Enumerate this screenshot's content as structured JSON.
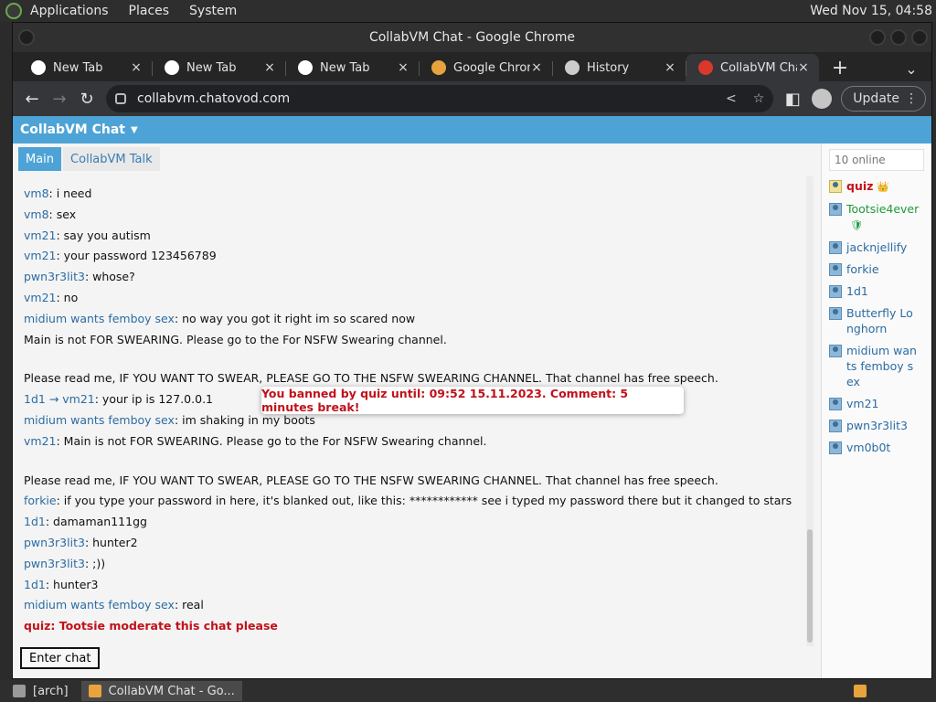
{
  "top_panel": {
    "menus": [
      "Applications",
      "Places",
      "System"
    ],
    "clock": "Wed Nov 15, 04:58"
  },
  "window": {
    "title": "CollabVM Chat - Google Chrome"
  },
  "tabs": [
    {
      "title": "New Tab",
      "icon": "chrome-new-tab-icon",
      "color": "#ffffff"
    },
    {
      "title": "New Tab",
      "icon": "chrome-new-tab-icon",
      "color": "#ffffff"
    },
    {
      "title": "New Tab",
      "icon": "chrome-new-tab-icon",
      "color": "#ffffff"
    },
    {
      "title": "Google Chrome",
      "icon": "chrome-logo-icon",
      "color": "#e8a33d"
    },
    {
      "title": "History",
      "icon": "history-icon",
      "color": "#cccccc"
    },
    {
      "title": "CollabVM Chat",
      "icon": "collabvm-icon",
      "color": "#d9382b"
    }
  ],
  "toolbar": {
    "url": "collabvm.chatovod.com",
    "update_label": "Update"
  },
  "page": {
    "navbar_title": "CollabVM Chat",
    "room_tabs": [
      "Main",
      "CollabVM Talk"
    ],
    "toast": "You banned by quiz until: 09:52 15.11.2023. Comment: 5 minutes break!",
    "enter_chat_label": "Enter chat",
    "online_count": "10 online",
    "messages": [
      {
        "nick": "vm8",
        "text": ": i need"
      },
      {
        "nick": "vm8",
        "text": ": sex"
      },
      {
        "nick": "vm21",
        "text": ": say you autism"
      },
      {
        "nick": "vm21",
        "text": ": your password 123456789"
      },
      {
        "nick": "pwn3r3lit3",
        "text": ": whose?"
      },
      {
        "nick": "vm21",
        "text": ": no"
      },
      {
        "nick": "midium wants femboy sex",
        "text": ": no way you got it right im so scared now"
      },
      {
        "nick": "",
        "text": "Main is not FOR SWEARING. Please go to the For NSFW Swearing channel."
      },
      {
        "nick": "",
        "text": ""
      },
      {
        "nick": "",
        "text": "Please read me, IF YOU WANT TO SWEAR, PLEASE GO TO THE NSFW SWEARING CHANNEL. That channel has free speech."
      },
      {
        "nick": "1d1 → vm21",
        "text": ": your ip is 127.0.0.1"
      },
      {
        "nick": "midium wants femboy sex",
        "text": ": im shaking in my boots"
      },
      {
        "nick": "vm21",
        "text": ": Main is not FOR SWEARING. Please go to the For NSFW Swearing channel."
      },
      {
        "nick": "",
        "text": ""
      },
      {
        "nick": "",
        "text": "Please read me, IF YOU WANT TO SWEAR, PLEASE GO TO THE NSFW SWEARING CHANNEL. That channel has free speech."
      },
      {
        "nick": "forkie",
        "text": ": if you type your password in here, it's blanked out, like this: ************ see i typed my password there but it changed to stars"
      },
      {
        "nick": "1d1",
        "text": ": damaman111gg"
      },
      {
        "nick": "pwn3r3lit3",
        "text": ": hunter2"
      },
      {
        "nick": "pwn3r3lit3",
        "text": ": ;))"
      },
      {
        "nick": "1d1",
        "text": ": hunter3"
      },
      {
        "nick": "midium wants femboy sex",
        "text": ": real"
      },
      {
        "nick": "quiz",
        "text": ": Tootsie moderate this chat please",
        "admin": true
      }
    ],
    "users": [
      {
        "name": "quiz",
        "role": "admin",
        "badge": "👑"
      },
      {
        "name": "Tootsie4ever",
        "role": "mod",
        "badge": "🛡"
      },
      {
        "name": "jacknjellify",
        "role": "user"
      },
      {
        "name": "forkie",
        "role": "user"
      },
      {
        "name": "1d1",
        "role": "user"
      },
      {
        "name": "Butterfly Longhorn",
        "role": "user"
      },
      {
        "name": "midium wants femboy sex",
        "role": "user"
      },
      {
        "name": "vm21",
        "role": "user"
      },
      {
        "name": "pwn3r3lit3",
        "role": "user"
      },
      {
        "name": "vm0b0t",
        "role": "user"
      }
    ]
  },
  "taskbar": {
    "items": [
      {
        "label": "[arch]",
        "icon": "folder-icon",
        "color": "#9a9a9a"
      },
      {
        "label": "CollabVM Chat - Go...",
        "icon": "chrome-logo-icon",
        "color": "#e8a33d"
      }
    ]
  },
  "colors": {
    "accent": "#4ea3d6",
    "admin": "#c1111a",
    "mod": "#1f9b36",
    "nick": "#2b6ca3"
  }
}
